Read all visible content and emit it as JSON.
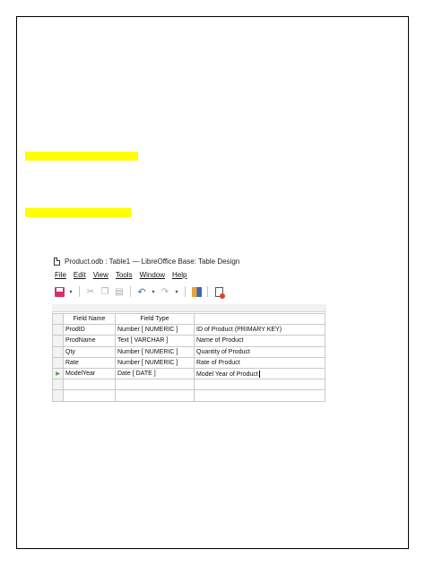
{
  "window": {
    "title": "Product.odb : Table1 — LibreOffice Base: Table Design",
    "menu": [
      "File",
      "Edit",
      "View",
      "Tools",
      "Window",
      "Help"
    ]
  },
  "grid": {
    "headers": [
      "Field Name",
      "Field Type",
      ""
    ],
    "rows": [
      {
        "name": "ProdID",
        "type": "Number [ NUMERIC ]",
        "desc": "ID of Product (PRIMARY KEY)"
      },
      {
        "name": "ProdName",
        "type": "Text [ VARCHAR ]",
        "desc": "Name of Product"
      },
      {
        "name": "Qty",
        "type": "Number [ NUMERIC ]",
        "desc": "Quantity of Product"
      },
      {
        "name": "Rate",
        "type": "Number [ NUMERIC ]",
        "desc": "Rate of Product"
      },
      {
        "name": "ModelYear",
        "type": "Date [ DATE ]",
        "desc": "Model Year of Product"
      }
    ],
    "current_row_marker": "▶"
  },
  "colors": {
    "highlight": "#ffff00",
    "save_icon": "#d8306a",
    "row_marker": "#3aa33a"
  }
}
